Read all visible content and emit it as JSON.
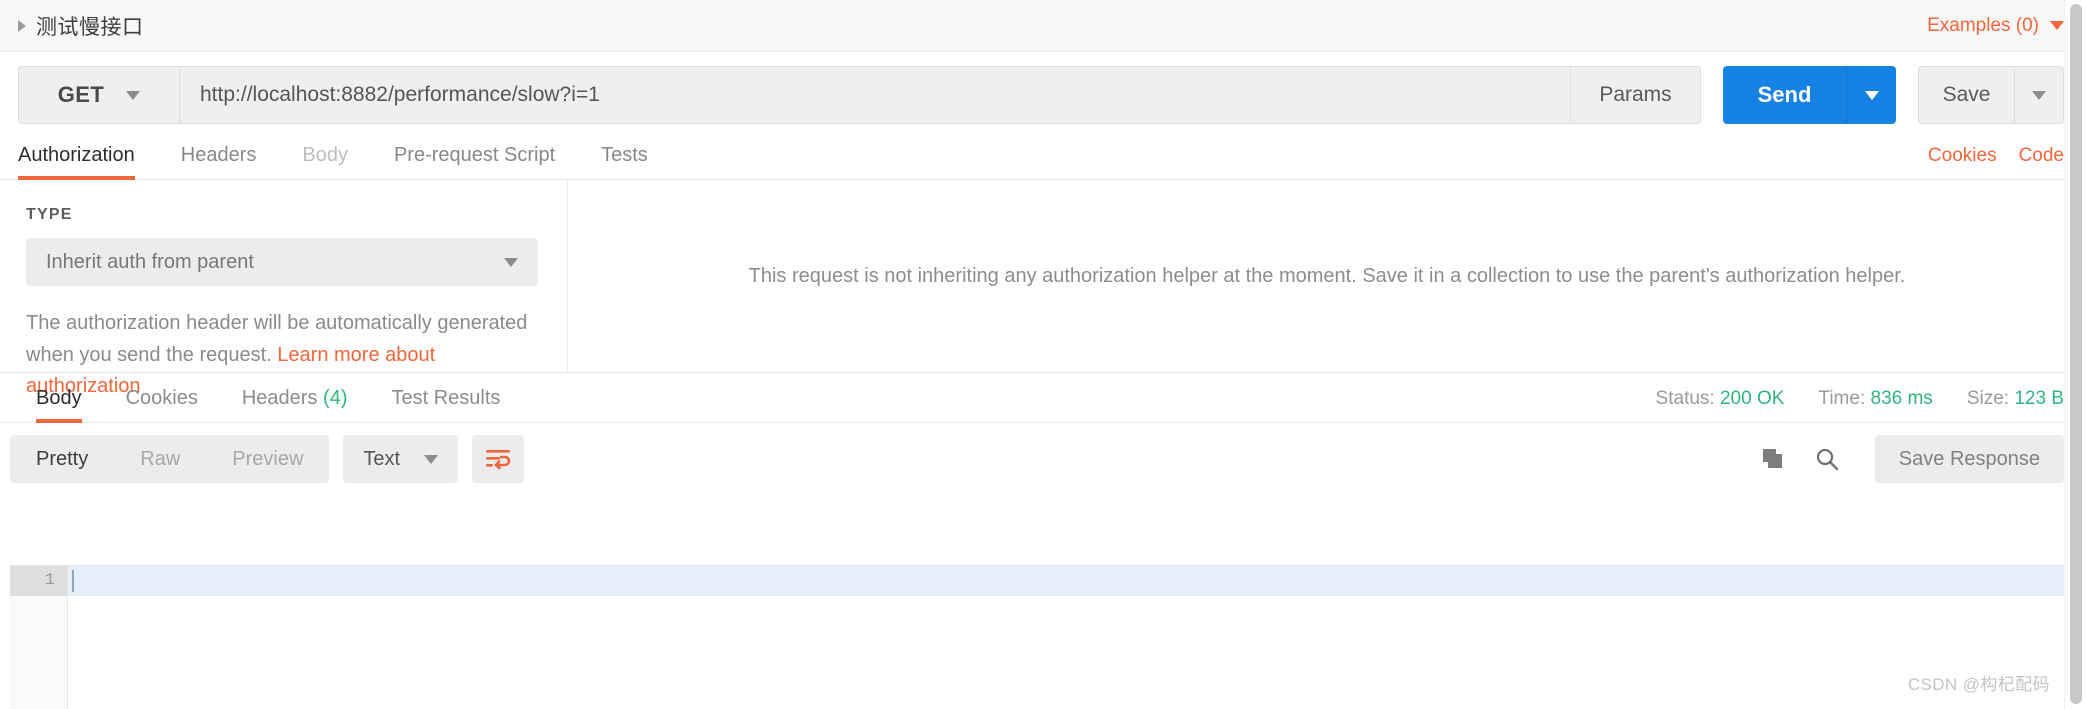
{
  "header": {
    "title": "测试慢接口",
    "collapse_icon": "triangle-right-icon",
    "examples_label": "Examples (0)",
    "examples_caret": "chevron-down-icon"
  },
  "url_row": {
    "method": "GET",
    "method_caret": "chevron-down-icon",
    "url_value": "http://localhost:8882/performance/slow?i=1",
    "url_placeholder": "Enter request URL",
    "params_label": "Params",
    "send_label": "Send",
    "send_caret": "chevron-down-icon",
    "save_label": "Save",
    "save_caret": "chevron-down-icon",
    "send_color": "#1683e4"
  },
  "request_tabs": {
    "items": [
      {
        "label": "Authorization",
        "state": "active"
      },
      {
        "label": "Headers",
        "state": "normal"
      },
      {
        "label": "Body",
        "state": "dim"
      },
      {
        "label": "Pre-request Script",
        "state": "normal"
      },
      {
        "label": "Tests",
        "state": "normal"
      }
    ],
    "right_links": [
      {
        "label": "Cookies"
      },
      {
        "label": "Code"
      }
    ],
    "accent_color": "#f1663a"
  },
  "auth": {
    "type_label": "TYPE",
    "type_value": "Inherit auth from parent",
    "type_caret": "chevron-down-icon",
    "help_text": "The authorization header will be automatically generated when you send the request.",
    "help_link": "Learn more about authorization",
    "right_message": "This request is not inheriting any authorization helper at the moment. Save it in a collection to use the parent's authorization helper."
  },
  "response_tabs": {
    "items": [
      {
        "label": "Body",
        "count": "",
        "state": "active"
      },
      {
        "label": "Cookies",
        "count": "",
        "state": "normal"
      },
      {
        "label": "Headers",
        "count": "(4)",
        "state": "normal"
      },
      {
        "label": "Test Results",
        "count": "",
        "state": "normal"
      }
    ],
    "status": {
      "status_key": "Status:",
      "status_value": "200 OK",
      "time_key": "Time:",
      "time_value": "836 ms",
      "size_key": "Size:",
      "size_value": "123 B",
      "value_color": "#31b57f"
    }
  },
  "body_toolbar": {
    "views": [
      {
        "label": "Pretty",
        "state": "active"
      },
      {
        "label": "Raw",
        "state": "normal"
      },
      {
        "label": "Preview",
        "state": "normal"
      }
    ],
    "format_value": "Text",
    "format_caret": "chevron-down-icon",
    "wrap_icon": "word-wrap-icon",
    "copy_icon": "copy-icon",
    "search_icon": "search-icon",
    "save_response_label": "Save Response"
  },
  "editor": {
    "line_numbers": [
      "1"
    ],
    "content": ""
  },
  "watermark": "CSDN @构杞配码"
}
